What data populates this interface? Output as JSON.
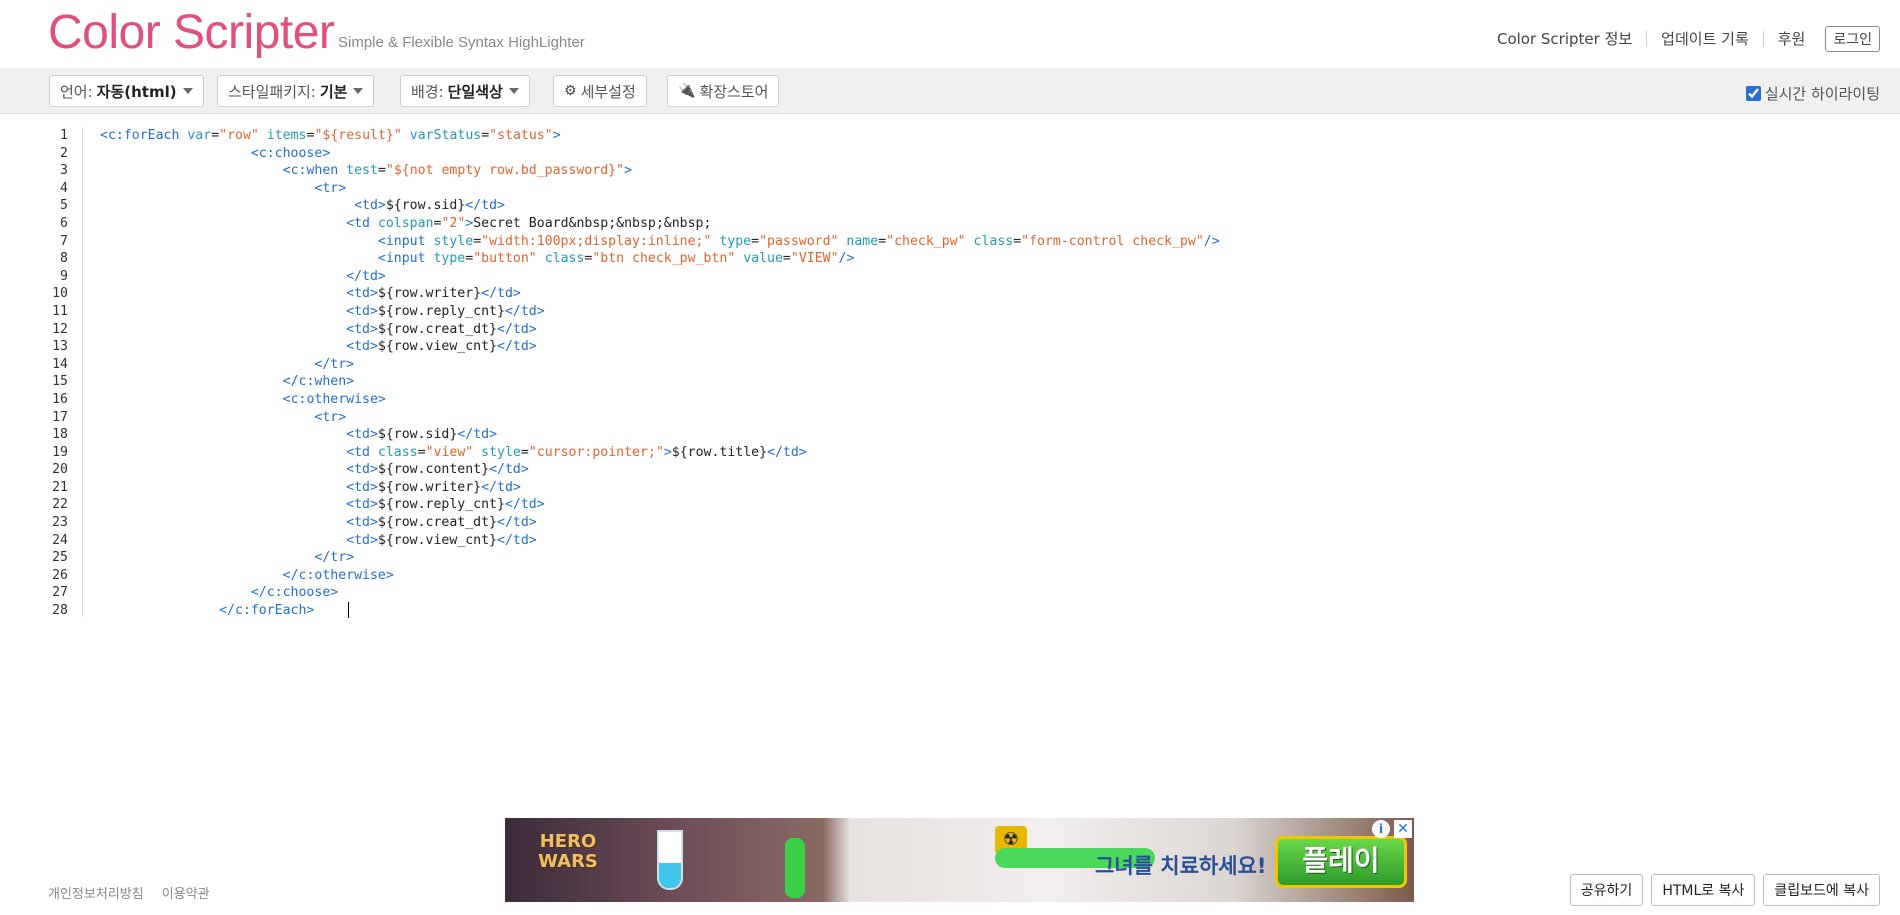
{
  "header": {
    "logo": "Color Scripter",
    "tagline": "Simple & Flexible Syntax HighLighter",
    "nav": [
      "Color Scripter 정보",
      "업데이트 기록",
      "후원"
    ],
    "login": "로그인"
  },
  "toolbar": {
    "language_label": "언어:",
    "language_value": "자동(html)",
    "style_label": "스타일패키지:",
    "style_value": "기본",
    "background_label": "배경:",
    "background_value": "단일색상",
    "settings": "세부설정",
    "extensions": "확장스토어",
    "live_highlight": "실시간 하이라이팅",
    "live_highlight_checked": true
  },
  "editor": {
    "lines": [
      "1",
      "2",
      "3",
      "4",
      "5",
      "6",
      "7",
      "8",
      "9",
      "10",
      "11",
      "12",
      "13",
      "14",
      "15",
      "16",
      "17",
      "18",
      "19",
      "20",
      "21",
      "22",
      "23",
      "24",
      "25",
      "26",
      "27",
      "28"
    ]
  },
  "ad": {
    "brand": "HERO WARS",
    "slogan": "그녀를 치료하세요!",
    "cta": "플레이",
    "info": "i",
    "close": "✕"
  },
  "footer": {
    "privacy": "개인정보처리방침",
    "terms": "이용약관",
    "share": "공유하기",
    "copy_html": "HTML로 복사",
    "copy_clipboard": "클립보드에 복사"
  }
}
